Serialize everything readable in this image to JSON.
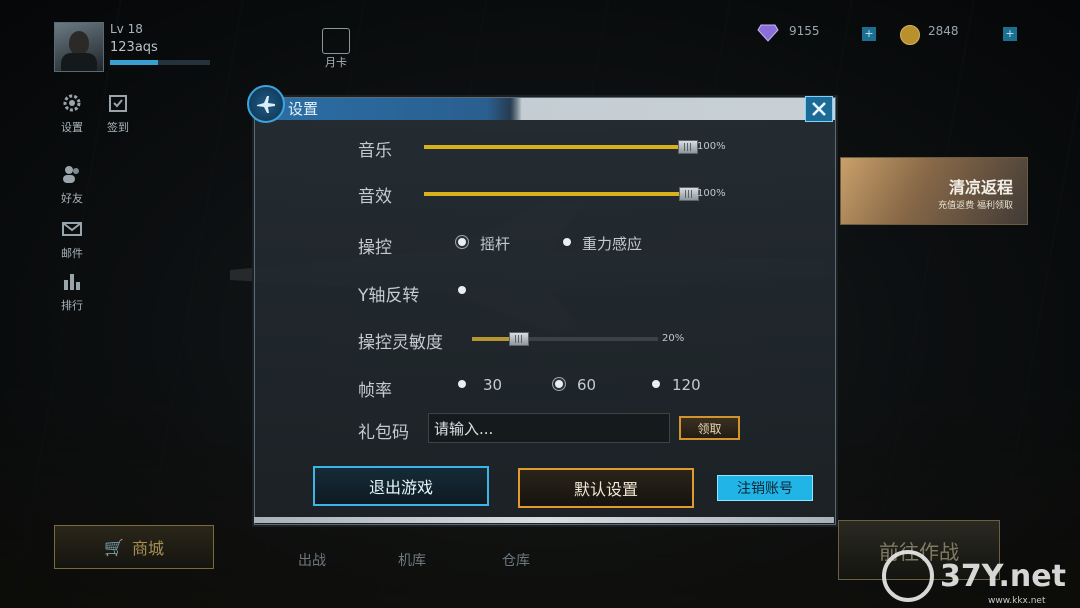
{
  "profile": {
    "level": "Lv 18",
    "name": "123aqs",
    "xp_fraction": 0.48
  },
  "top": {
    "month_card": "月卡",
    "gems": "9155",
    "coins": "2848"
  },
  "side_menu": [
    {
      "icon": "gear-icon",
      "label": "设置"
    },
    {
      "icon": "calendar-check-icon",
      "label": "签到"
    },
    {
      "icon": "friends-icon",
      "label": "好友"
    },
    {
      "icon": "mail-icon",
      "label": "邮件"
    },
    {
      "icon": "ranking-icon",
      "label": "排行"
    }
  ],
  "shop": {
    "label": "商城"
  },
  "bottom_nav": [
    "出战",
    "机库",
    "仓库"
  ],
  "go_battle": "前往作战",
  "banner": {
    "title": "清凉返程",
    "subtitle": "充值返费  福利领取"
  },
  "dialog": {
    "title": "设置",
    "music": {
      "label": "音乐",
      "value": 100,
      "text": "100%"
    },
    "sfx": {
      "label": "音效",
      "value": 100,
      "text": "100%"
    },
    "control": {
      "label": "操控",
      "options": [
        "摇杆",
        "重力感应"
      ],
      "selected": "摇杆"
    },
    "invert_y": {
      "label": "Y轴反转"
    },
    "sensitivity": {
      "label": "操控灵敏度",
      "value": 20,
      "text": "20%"
    },
    "framerate": {
      "label": "帧率",
      "options": [
        "30",
        "60",
        "120"
      ],
      "selected": "60"
    },
    "gift": {
      "label": "礼包码",
      "placeholder": "请输入...",
      "claim": "领取"
    },
    "buttons": {
      "exit": "退出游戏",
      "default": "默认设置",
      "logout": "注销账号"
    }
  },
  "watermark": {
    "text": "37Y.net",
    "url": "www.kkx.net"
  },
  "colors": {
    "accent_blue": "#3cb4e8",
    "accent_gold": "#d8b21e",
    "orange": "#e09a2e"
  }
}
